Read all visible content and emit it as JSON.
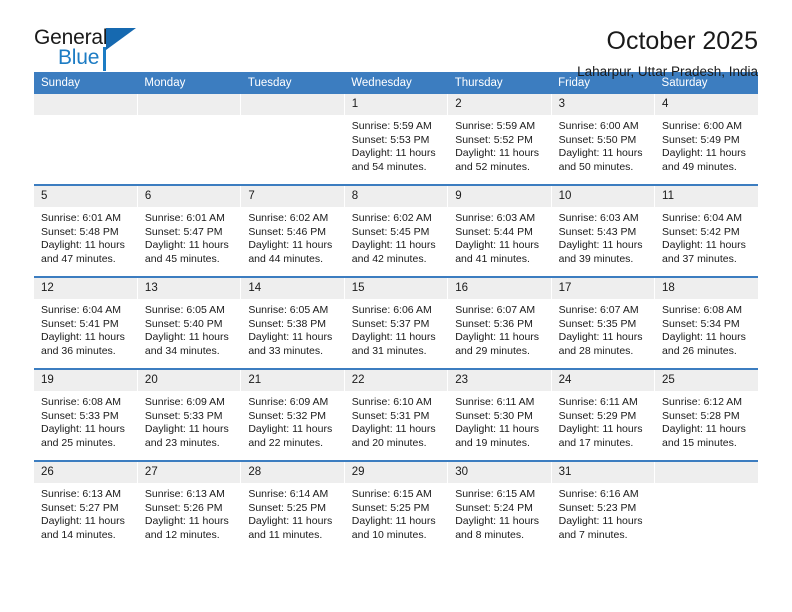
{
  "brand": {
    "name_part1": "General",
    "name_part2": "Blue",
    "accent_color": "#1d7cc4",
    "triangle_color": "#1669b0"
  },
  "header": {
    "title": "October 2025",
    "location": "Laharpur, Uttar Pradesh, India"
  },
  "calendar": {
    "header_bg": "#3c7dc0",
    "daynum_bg": "#eeeeee",
    "weekday_headers": [
      "Sunday",
      "Monday",
      "Tuesday",
      "Wednesday",
      "Thursday",
      "Friday",
      "Saturday"
    ],
    "weeks": [
      [
        {
          "empty": true
        },
        {
          "empty": true
        },
        {
          "empty": true
        },
        {
          "day": "1",
          "sunrise": "Sunrise: 5:59 AM",
          "sunset": "Sunset: 5:53 PM",
          "daylight_line1": "Daylight: 11 hours",
          "daylight_line2": "and 54 minutes."
        },
        {
          "day": "2",
          "sunrise": "Sunrise: 5:59 AM",
          "sunset": "Sunset: 5:52 PM",
          "daylight_line1": "Daylight: 11 hours",
          "daylight_line2": "and 52 minutes."
        },
        {
          "day": "3",
          "sunrise": "Sunrise: 6:00 AM",
          "sunset": "Sunset: 5:50 PM",
          "daylight_line1": "Daylight: 11 hours",
          "daylight_line2": "and 50 minutes."
        },
        {
          "day": "4",
          "sunrise": "Sunrise: 6:00 AM",
          "sunset": "Sunset: 5:49 PM",
          "daylight_line1": "Daylight: 11 hours",
          "daylight_line2": "and 49 minutes."
        }
      ],
      [
        {
          "day": "5",
          "sunrise": "Sunrise: 6:01 AM",
          "sunset": "Sunset: 5:48 PM",
          "daylight_line1": "Daylight: 11 hours",
          "daylight_line2": "and 47 minutes."
        },
        {
          "day": "6",
          "sunrise": "Sunrise: 6:01 AM",
          "sunset": "Sunset: 5:47 PM",
          "daylight_line1": "Daylight: 11 hours",
          "daylight_line2": "and 45 minutes."
        },
        {
          "day": "7",
          "sunrise": "Sunrise: 6:02 AM",
          "sunset": "Sunset: 5:46 PM",
          "daylight_line1": "Daylight: 11 hours",
          "daylight_line2": "and 44 minutes."
        },
        {
          "day": "8",
          "sunrise": "Sunrise: 6:02 AM",
          "sunset": "Sunset: 5:45 PM",
          "daylight_line1": "Daylight: 11 hours",
          "daylight_line2": "and 42 minutes."
        },
        {
          "day": "9",
          "sunrise": "Sunrise: 6:03 AM",
          "sunset": "Sunset: 5:44 PM",
          "daylight_line1": "Daylight: 11 hours",
          "daylight_line2": "and 41 minutes."
        },
        {
          "day": "10",
          "sunrise": "Sunrise: 6:03 AM",
          "sunset": "Sunset: 5:43 PM",
          "daylight_line1": "Daylight: 11 hours",
          "daylight_line2": "and 39 minutes."
        },
        {
          "day": "11",
          "sunrise": "Sunrise: 6:04 AM",
          "sunset": "Sunset: 5:42 PM",
          "daylight_line1": "Daylight: 11 hours",
          "daylight_line2": "and 37 minutes."
        }
      ],
      [
        {
          "day": "12",
          "sunrise": "Sunrise: 6:04 AM",
          "sunset": "Sunset: 5:41 PM",
          "daylight_line1": "Daylight: 11 hours",
          "daylight_line2": "and 36 minutes."
        },
        {
          "day": "13",
          "sunrise": "Sunrise: 6:05 AM",
          "sunset": "Sunset: 5:40 PM",
          "daylight_line1": "Daylight: 11 hours",
          "daylight_line2": "and 34 minutes."
        },
        {
          "day": "14",
          "sunrise": "Sunrise: 6:05 AM",
          "sunset": "Sunset: 5:38 PM",
          "daylight_line1": "Daylight: 11 hours",
          "daylight_line2": "and 33 minutes."
        },
        {
          "day": "15",
          "sunrise": "Sunrise: 6:06 AM",
          "sunset": "Sunset: 5:37 PM",
          "daylight_line1": "Daylight: 11 hours",
          "daylight_line2": "and 31 minutes."
        },
        {
          "day": "16",
          "sunrise": "Sunrise: 6:07 AM",
          "sunset": "Sunset: 5:36 PM",
          "daylight_line1": "Daylight: 11 hours",
          "daylight_line2": "and 29 minutes."
        },
        {
          "day": "17",
          "sunrise": "Sunrise: 6:07 AM",
          "sunset": "Sunset: 5:35 PM",
          "daylight_line1": "Daylight: 11 hours",
          "daylight_line2": "and 28 minutes."
        },
        {
          "day": "18",
          "sunrise": "Sunrise: 6:08 AM",
          "sunset": "Sunset: 5:34 PM",
          "daylight_line1": "Daylight: 11 hours",
          "daylight_line2": "and 26 minutes."
        }
      ],
      [
        {
          "day": "19",
          "sunrise": "Sunrise: 6:08 AM",
          "sunset": "Sunset: 5:33 PM",
          "daylight_line1": "Daylight: 11 hours",
          "daylight_line2": "and 25 minutes."
        },
        {
          "day": "20",
          "sunrise": "Sunrise: 6:09 AM",
          "sunset": "Sunset: 5:33 PM",
          "daylight_line1": "Daylight: 11 hours",
          "daylight_line2": "and 23 minutes."
        },
        {
          "day": "21",
          "sunrise": "Sunrise: 6:09 AM",
          "sunset": "Sunset: 5:32 PM",
          "daylight_line1": "Daylight: 11 hours",
          "daylight_line2": "and 22 minutes."
        },
        {
          "day": "22",
          "sunrise": "Sunrise: 6:10 AM",
          "sunset": "Sunset: 5:31 PM",
          "daylight_line1": "Daylight: 11 hours",
          "daylight_line2": "and 20 minutes."
        },
        {
          "day": "23",
          "sunrise": "Sunrise: 6:11 AM",
          "sunset": "Sunset: 5:30 PM",
          "daylight_line1": "Daylight: 11 hours",
          "daylight_line2": "and 19 minutes."
        },
        {
          "day": "24",
          "sunrise": "Sunrise: 6:11 AM",
          "sunset": "Sunset: 5:29 PM",
          "daylight_line1": "Daylight: 11 hours",
          "daylight_line2": "and 17 minutes."
        },
        {
          "day": "25",
          "sunrise": "Sunrise: 6:12 AM",
          "sunset": "Sunset: 5:28 PM",
          "daylight_line1": "Daylight: 11 hours",
          "daylight_line2": "and 15 minutes."
        }
      ],
      [
        {
          "day": "26",
          "sunrise": "Sunrise: 6:13 AM",
          "sunset": "Sunset: 5:27 PM",
          "daylight_line1": "Daylight: 11 hours",
          "daylight_line2": "and 14 minutes."
        },
        {
          "day": "27",
          "sunrise": "Sunrise: 6:13 AM",
          "sunset": "Sunset: 5:26 PM",
          "daylight_line1": "Daylight: 11 hours",
          "daylight_line2": "and 12 minutes."
        },
        {
          "day": "28",
          "sunrise": "Sunrise: 6:14 AM",
          "sunset": "Sunset: 5:25 PM",
          "daylight_line1": "Daylight: 11 hours",
          "daylight_line2": "and 11 minutes."
        },
        {
          "day": "29",
          "sunrise": "Sunrise: 6:15 AM",
          "sunset": "Sunset: 5:25 PM",
          "daylight_line1": "Daylight: 11 hours",
          "daylight_line2": "and 10 minutes."
        },
        {
          "day": "30",
          "sunrise": "Sunrise: 6:15 AM",
          "sunset": "Sunset: 5:24 PM",
          "daylight_line1": "Daylight: 11 hours",
          "daylight_line2": "and 8 minutes."
        },
        {
          "day": "31",
          "sunrise": "Sunrise: 6:16 AM",
          "sunset": "Sunset: 5:23 PM",
          "daylight_line1": "Daylight: 11 hours",
          "daylight_line2": "and 7 minutes."
        },
        {
          "empty": true
        }
      ]
    ]
  }
}
